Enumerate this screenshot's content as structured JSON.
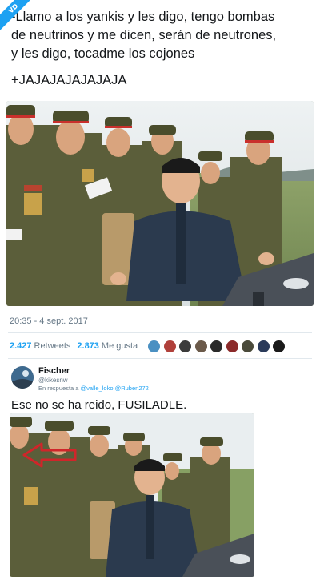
{
  "badge": {
    "label": "VD"
  },
  "tweet": {
    "line1": "-Llamo a los yankis y les digo, tengo bombas",
    "line2": "de neutrinos y me dicen, serán de neutrones,",
    "line3": "y les digo, tocadme los cojones",
    "laugh": "+JAJAJAJAJAJAJA",
    "timestamp": "20:35 - 4 sept. 2017",
    "retweets_count": "2.427",
    "retweets_label": "Retweets",
    "likes_count": "2.873",
    "likes_label": "Me gusta",
    "liker_avatar_colors": [
      "#4a90c2",
      "#b0403a",
      "#3b3b3b",
      "#6b5a4a",
      "#2a2a2a",
      "#8b2a2a",
      "#4a4a3a",
      "#2a3a5a",
      "#1a1a1a"
    ]
  },
  "reply": {
    "name": "Fischer",
    "handle": "@kikesnw",
    "reply_prefix": "En respuesta a",
    "mention1": "@valle_loko",
    "mention2": "@Ruben272",
    "text": "Ese no se ha reido, FUSILADLE."
  },
  "colors": {
    "accent": "#1da1f2",
    "uniform": "#5b5e3a",
    "suit": "#2b3a4e",
    "sky": "#e9eef0",
    "arrow": "#d0252a"
  }
}
